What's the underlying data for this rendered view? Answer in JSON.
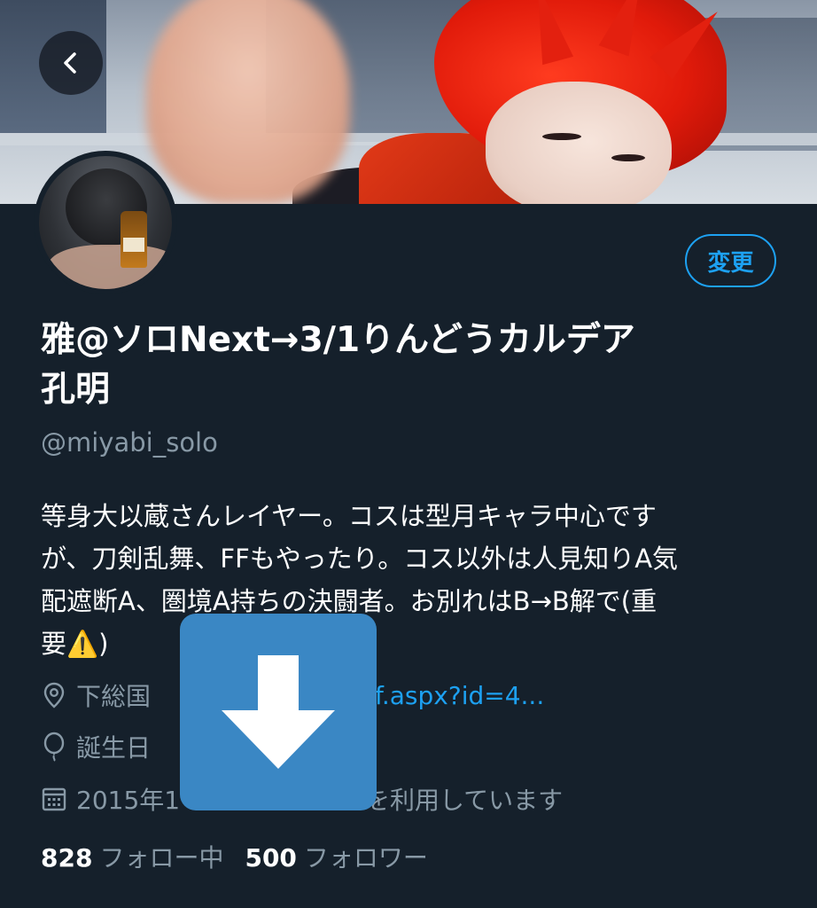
{
  "header": {
    "back_icon": "chevron-left-icon"
  },
  "profile": {
    "edit_label": "変更",
    "name_line1": "雅@ソロNext→3/1りんどうカルデア",
    "name_line2": "孔明",
    "handle": "@miyabi_solo",
    "bio_lines": [
      "等身大以蔵さんレイヤー。コスは型月キャラ中心です",
      "が、刀剣乱舞、FFもやったり。コス以外は人見知りA気",
      "配遮断A、圏境A持ちの決闘者。お別れはB→B解で(重",
      "要⚠️)"
    ],
    "location": "下総国",
    "link": "rof.aspx?id=4...",
    "birthday": "誕生日",
    "joined_prefix": "2015年1",
    "joined_suffix": "を利用しています",
    "following_count": "828",
    "following_label": "フォロー中",
    "followers_count": "500",
    "followers_label": "フォロワー"
  },
  "overlay": {
    "icon": "download-arrow-icon"
  },
  "colors": {
    "background": "#15202b",
    "accent": "#1da1f2",
    "secondary_text": "#8899a6",
    "overlay": "#3a87c4"
  }
}
